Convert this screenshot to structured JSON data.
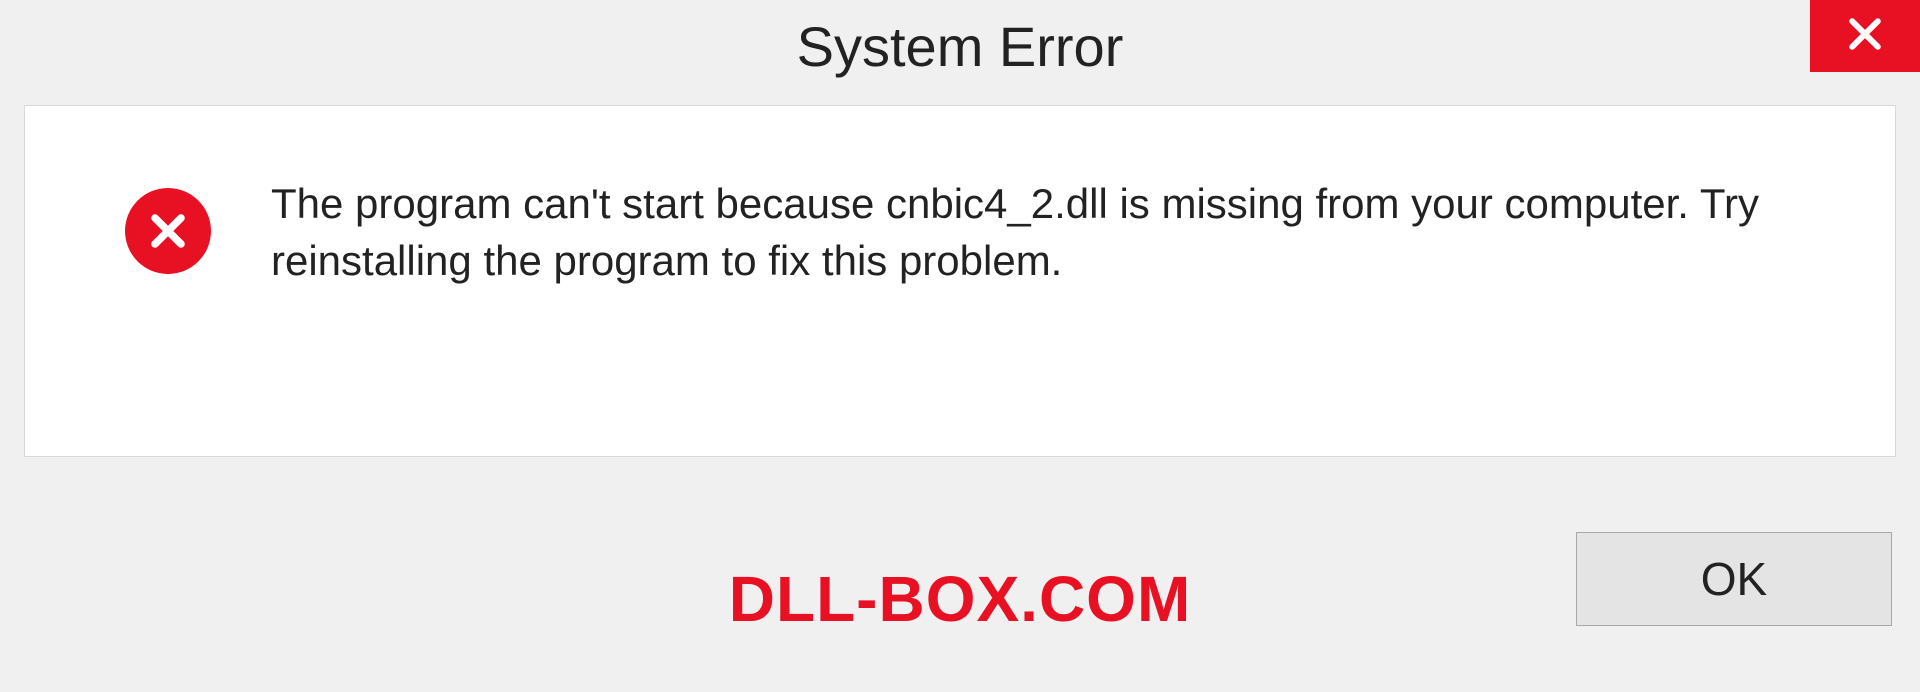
{
  "dialog": {
    "title": "System Error",
    "message": "The program can't start because cnbic4_2.dll is missing from your computer. Try reinstalling the program to fix this problem.",
    "ok_label": "OK"
  },
  "watermark": {
    "text": "DLL-BOX.COM"
  },
  "colors": {
    "accent_red": "#e81123",
    "background": "#f0f0f0",
    "content_bg": "#ffffff",
    "button_bg": "#e4e4e4"
  }
}
